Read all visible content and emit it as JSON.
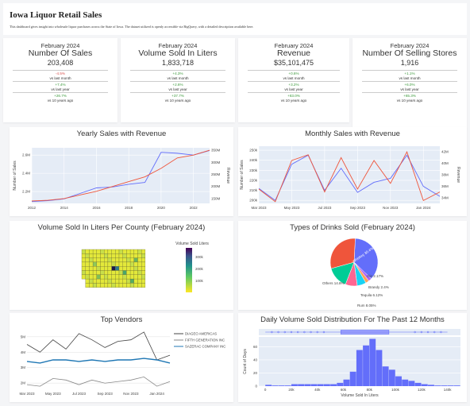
{
  "header": {
    "title": "Iowa Liquor Retail Sales",
    "description": "This dashboard gives insight into wholesale liquor purchases across the State of Iowa. The dataset utilized is openly accessible via BigQuery, with a detailed description available here."
  },
  "kpis": [
    {
      "period": "February 2024",
      "title": "Number Of Sales",
      "value": "203,408",
      "rows": [
        {
          "pct": "-4.5%",
          "label": "vs last month",
          "tone": "neg"
        },
        {
          "pct": "+7.4%",
          "label": "vs last year",
          "tone": "pos"
        },
        {
          "pct": "+26.7%",
          "label": "vs 10 years ago",
          "tone": "pos"
        }
      ]
    },
    {
      "period": "February 2024",
      "title": "Volume Sold In Liters",
      "value": "1,833,718",
      "rows": [
        {
          "pct": "+4.3%",
          "label": "vs last month",
          "tone": "pos"
        },
        {
          "pct": "+2.6%",
          "label": "vs last year",
          "tone": "pos"
        },
        {
          "pct": "+37.7%",
          "label": "vs 10 years ago",
          "tone": "pos"
        }
      ]
    },
    {
      "period": "February 2024",
      "title": "Revenue",
      "value": "$35,101,475",
      "rows": [
        {
          "pct": "+0.6%",
          "label": "vs last month",
          "tone": "pos"
        },
        {
          "pct": "+3.2%",
          "label": "vs last year",
          "tone": "pos"
        },
        {
          "pct": "+83.0%",
          "label": "vs 10 years ago",
          "tone": "pos"
        }
      ]
    },
    {
      "period": "February 2024",
      "title": "Number Of Selling Stores",
      "value": "1,916",
      "rows": [
        {
          "pct": "+1.1%",
          "label": "vs last month",
          "tone": "pos"
        },
        {
          "pct": "+6.0%",
          "label": "vs last year",
          "tone": "pos"
        },
        {
          "pct": "+65.3%",
          "label": "vs 10 years ago",
          "tone": "pos"
        }
      ]
    }
  ],
  "colors": {
    "blue": "#636efa",
    "red": "#ef553b",
    "green": "#00cc96",
    "purple": "#ab63fa",
    "orange": "#ffa15a",
    "cyan": "#19d3f3",
    "pink": "#ff6692",
    "plot_bg": "#e5ecf6"
  },
  "charts": {
    "yearly": {
      "title": "Yearly Sales with Revenue"
    },
    "monthly": {
      "title": "Monthly Sales with Revenue"
    },
    "county": {
      "title": "Volume Sold In Liters Per County (February 2024)"
    },
    "drinks": {
      "title": "Types of Drinks Sold (February 2024)"
    },
    "vendors": {
      "title": "Top Vendors"
    },
    "daily": {
      "title": "Daily Volume Sold Distribution For The Past 12 Months"
    }
  },
  "chart_data": [
    {
      "type": "line",
      "title": "Yearly Sales with Revenue",
      "ylabel": "Number of Sales",
      "y2label": "Revenue",
      "x": [
        2012,
        2013,
        2014,
        2015,
        2016,
        2017,
        2018,
        2019,
        2020,
        2021,
        2022,
        2023
      ],
      "xticks": [
        "2012",
        "2014",
        "2016",
        "2018",
        "2020",
        "2022"
      ],
      "yticks": [
        "2.2M",
        "2.4M",
        "2.6M"
      ],
      "y2ticks": [
        "150M",
        "200M",
        "250M",
        "300M",
        "350M"
      ],
      "ylim": [
        2.07,
        2.68
      ],
      "y2lim": [
        130,
        360
      ],
      "series": [
        {
          "values": [
            2.09,
            2.1,
            2.12,
            2.18,
            2.24,
            2.25,
            2.28,
            2.3,
            2.63,
            2.62,
            2.6,
            2.65
          ],
          "axis": "y",
          "color": "#636efa"
        },
        {
          "values": [
            140,
            143,
            150,
            165,
            180,
            200,
            220,
            240,
            275,
            318,
            330,
            350
          ],
          "axis": "y2",
          "color": "#ef553b"
        }
      ]
    },
    {
      "type": "line",
      "title": "Monthly Sales with Revenue",
      "ylabel": "Number of Sales",
      "y2label": "Revenue",
      "x": [
        "Mar 2023",
        "Apr 2023",
        "May 2023",
        "Jun 2023",
        "Jul 2023",
        "Aug 2023",
        "Sep 2023",
        "Oct 2023",
        "Nov 2023",
        "Dec 2023",
        "Jan 2024",
        "Feb 2024"
      ],
      "xticks": [
        "Mar 2023",
        "May 2023",
        "Jul 2023",
        "Sep 2023",
        "Nov 2023",
        "Jan 2024"
      ],
      "yticks": [
        "200k",
        "210k",
        "220k",
        "230k",
        "240k",
        "250k"
      ],
      "y2ticks": [
        "34M",
        "36M",
        "38M",
        "40M",
        "42M"
      ],
      "ylim": [
        197,
        254
      ],
      "y2lim": [
        33,
        43
      ],
      "series": [
        {
          "values": [
            212,
            200,
            236,
            245,
            210,
            232,
            208,
            218,
            222,
            245,
            214,
            204
          ],
          "axis": "y",
          "color": "#636efa"
        },
        {
          "values": [
            35.5,
            33.3,
            40.5,
            41.5,
            35.0,
            41.0,
            35.5,
            40.5,
            36.5,
            42.0,
            33.5,
            35.0
          ],
          "axis": "y2",
          "color": "#ef553b"
        }
      ]
    },
    {
      "type": "heatmap",
      "title": "Volume Sold In Liters Per County (February 2024)",
      "colorbar_title": "Volume Sold Liters",
      "colorbar_ticks": [
        "300k",
        "200k",
        "100k"
      ]
    },
    {
      "type": "pie",
      "title": "Types of Drinks Sold (February 2024)",
      "labels": [
        "Whiskey",
        "Gin",
        "Brandy",
        "Tequila",
        "Rum",
        "Others",
        "Vodka"
      ],
      "values": [
        36.4,
        2.17,
        2.4,
        6.12,
        8.05,
        14.8,
        30.08
      ],
      "text": [
        "Whiskey 36.4%",
        "Gin 2.17%",
        "Brandy 2.4%",
        "Tequila 6.12%",
        "Rum 8.05%",
        "Others 14.8%",
        ""
      ],
      "colors": [
        "#636efa",
        "#ab63fa",
        "#ffa15a",
        "#19d3f3",
        "#ff6692",
        "#00cc96",
        "#ef553b"
      ]
    },
    {
      "type": "line",
      "title": "Top Vendors",
      "x": [
        "Mar 2023",
        "Apr 2023",
        "May 2023",
        "Jun 2023",
        "Jul 2023",
        "Aug 2023",
        "Sep 2023",
        "Oct 2023",
        "Nov 2023",
        "Dec 2023",
        "Jan 2024",
        "Feb 2024"
      ],
      "xticks": [
        "Mar 2023",
        "May 2023",
        "Jul 2023",
        "Sep 2023",
        "Nov 2023",
        "Jan 2024"
      ],
      "yticks": [
        "2M",
        "3M",
        "4M",
        "5M"
      ],
      "ylim": [
        1.6,
        5.4
      ],
      "series": [
        {
          "name": "DIAGEO AMERICAS",
          "values": [
            4.5,
            4.0,
            4.8,
            4.2,
            5.2,
            4.8,
            4.3,
            4.7,
            4.8,
            5.3,
            3.5,
            3.8
          ],
          "color": "#444444"
        },
        {
          "name": "FIFTH GENERATION INC",
          "values": [
            1.9,
            1.8,
            2.3,
            2.2,
            1.9,
            2.2,
            2.0,
            2.1,
            2.2,
            2.4,
            1.8,
            2.1
          ],
          "color": "#888888"
        },
        {
          "name": "SAZERAC COMPANY  INC",
          "values": [
            3.4,
            3.3,
            3.5,
            3.5,
            3.4,
            3.5,
            3.4,
            3.5,
            3.5,
            3.6,
            3.5,
            3.3
          ],
          "color": "#1f77b4"
        }
      ]
    },
    {
      "type": "bar",
      "title": "Daily Volume Sold Distribution For The Past 12 Months",
      "xlabel": "Volume Sold In Liters",
      "ylabel": "Count of Days",
      "xticks": [
        "0",
        "20k",
        "40k",
        "60k",
        "80k",
        "100k",
        "120k",
        "140k"
      ],
      "yticks": [
        "0",
        "20",
        "40",
        "60"
      ],
      "xlim": [
        -5,
        150
      ],
      "ylim": [
        0,
        75
      ],
      "bin_width": 5,
      "bin_starts": [
        0,
        5,
        10,
        15,
        20,
        25,
        30,
        35,
        40,
        45,
        50,
        55,
        60,
        65,
        70,
        75,
        80,
        85,
        90,
        95,
        100,
        105,
        110,
        115,
        120,
        125,
        130,
        135,
        140,
        145
      ],
      "values": [
        2,
        1,
        1,
        1,
        3,
        3,
        3,
        3,
        3,
        3,
        3,
        5,
        10,
        22,
        55,
        62,
        72,
        55,
        30,
        25,
        15,
        10,
        8,
        5,
        3,
        2,
        1,
        1,
        1,
        1
      ]
    }
  ]
}
